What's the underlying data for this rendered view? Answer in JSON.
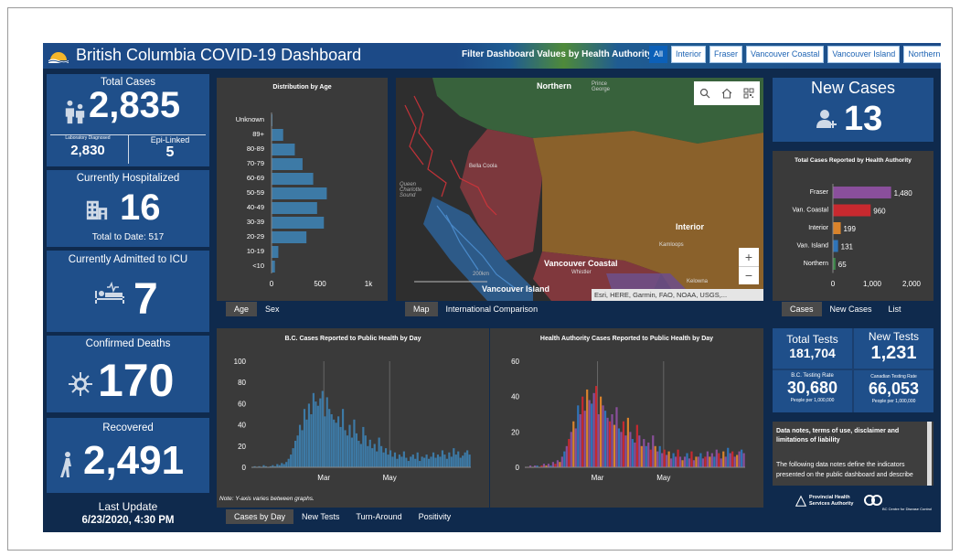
{
  "header": {
    "title": "British Columbia COVID-19 Dashboard",
    "filter_label": "Filter Dashboard Values by Health Authority:",
    "filters": [
      "All",
      "Interior",
      "Fraser",
      "Vancouver Coastal",
      "Vancouver Island",
      "Northern"
    ],
    "active_filter": "All"
  },
  "total_cases": {
    "label": "Total Cases",
    "value": "2,835",
    "lab_label": "Laboratory Diagnosed",
    "lab_value": "2,830",
    "epi_label": "Epi-Linked",
    "epi_value": "5"
  },
  "hospitalized": {
    "label": "Currently Hospitalized",
    "value": "16",
    "total_label": "Total to Date: 517"
  },
  "icu": {
    "label": "Currently Admitted to ICU",
    "value": "7"
  },
  "deaths": {
    "label": "Confirmed Deaths",
    "value": "170"
  },
  "recovered": {
    "label": "Recovered",
    "value": "2,491"
  },
  "last_update": {
    "label": "Last Update",
    "value": "6/23/2020, 4:30 PM"
  },
  "age_chart": {
    "tabs": [
      "Age",
      "Sex"
    ],
    "active_tab": "Age"
  },
  "map": {
    "labels": {
      "northern": "Northern",
      "prince_george": "Prince George",
      "bella_coola": "Bella Coola",
      "queen_charlotte": "Queen Charlotte Sound",
      "interior": "Interior",
      "kamloops": "Kamloops",
      "vancouver_coastal": "Vancouver Coastal",
      "whistler": "Whistler",
      "vancouver_island": "Vancouver Island",
      "kelowna": "Kelowna",
      "scale": "200km"
    },
    "attribution": "Esri, HERE, Garmin, FAO, NOAA, USGS,...",
    "zoom_in": "+",
    "zoom_out": "−",
    "tabs": [
      "Map",
      "International Comparison"
    ],
    "active_tab": "Map"
  },
  "new_cases": {
    "label": "New Cases",
    "value": "13"
  },
  "ha_chart": {
    "tabs": [
      "Cases",
      "New Cases",
      "List"
    ],
    "active_tab": "Cases"
  },
  "bc_daily": {
    "note": "Note: Y-axis varies between graphs.",
    "tabs": [
      "Cases by Day",
      "New Tests",
      "Turn-Around",
      "Positivity"
    ],
    "active_tab": "Cases by Day"
  },
  "tests": {
    "total_label": "Total Tests",
    "total_value": "181,704",
    "new_label": "New Tests",
    "new_value": "1,231",
    "bc_rate_label": "B.C. Testing Rate",
    "bc_rate_value": "30,680",
    "bc_rate_unit": "People per 1,000,000",
    "ca_rate_label": "Canadian Testing Rate",
    "ca_rate_value": "66,053",
    "ca_rate_unit": "People per 1,000,000"
  },
  "notes": {
    "title": "Data notes, terms of use, disclaimer and limitations of liability",
    "body": "The following data notes define the indicators presented on the public dashboard and describe"
  },
  "footer_logos": {
    "phsa_line1": "Provincial Health",
    "phsa_line2": "Services Authority",
    "bccdc": "BC Centre for Disease Control"
  },
  "colors": {
    "fraser": "#8a4f9c",
    "vancouver_coastal": "#c8292f",
    "interior": "#d9832b",
    "vancouver_island": "#2f74b8",
    "northern": "#3d8a4a",
    "bars": "#3d7aa6"
  },
  "chart_data": [
    {
      "type": "bar",
      "title": "Distribution by Age",
      "orientation": "horizontal",
      "categories": [
        "Unknown",
        "89+",
        "80-89",
        "70-79",
        "60-69",
        "50-59",
        "40-49",
        "30-39",
        "20-29",
        "10-19",
        "<10"
      ],
      "values": [
        5,
        120,
        240,
        320,
        430,
        570,
        470,
        540,
        360,
        70,
        35
      ],
      "xticks": [
        "0",
        "500",
        "1k"
      ],
      "xlim": [
        0,
        1000
      ]
    },
    {
      "type": "bar",
      "title": "Total Cases Reported by Health Authority",
      "orientation": "horizontal",
      "categories": [
        "Fraser",
        "Van. Coastal",
        "Interior",
        "Van. Island",
        "Northern"
      ],
      "values": [
        1480,
        960,
        199,
        131,
        65
      ],
      "value_labels": [
        "1,480",
        "960",
        "199",
        "131",
        "65"
      ],
      "xticks": [
        "0",
        "1,000",
        "2,000"
      ],
      "xlim": [
        0,
        2000
      ]
    },
    {
      "type": "bar",
      "title": "B.C. Cases Reported to Public Health by Day",
      "yticks": [
        "0",
        "20",
        "40",
        "60",
        "80",
        "100"
      ],
      "ylim": [
        0,
        100
      ],
      "xtick_labels": [
        "Mar",
        "May"
      ],
      "values": [
        0,
        1,
        0,
        1,
        0,
        2,
        1,
        0,
        1,
        2,
        1,
        3,
        2,
        4,
        3,
        5,
        8,
        12,
        18,
        25,
        30,
        40,
        35,
        55,
        45,
        60,
        50,
        70,
        62,
        58,
        65,
        72,
        48,
        66,
        55,
        50,
        45,
        42,
        48,
        38,
        55,
        35,
        30,
        40,
        28,
        45,
        32,
        25,
        22,
        38,
        30,
        20,
        26,
        18,
        22,
        15,
        28,
        20,
        14,
        18,
        12,
        16,
        10,
        14,
        8,
        12,
        10,
        15,
        9,
        6,
        10,
        12,
        8,
        14,
        6,
        10,
        9,
        12,
        8,
        10,
        14,
        9,
        12,
        10,
        16,
        12,
        8,
        14,
        10,
        18,
        12,
        15,
        9,
        11,
        14,
        16,
        12
      ]
    },
    {
      "type": "bar",
      "title": "Health Authority Cases Reported to Public Health by Day",
      "yticks": [
        "0",
        "20",
        "40",
        "60"
      ],
      "ylim": [
        0,
        60
      ],
      "xtick_labels": [
        "Mar",
        "May"
      ],
      "values": [
        0,
        0,
        1,
        0,
        1,
        1,
        0,
        1,
        2,
        1,
        2,
        1,
        3,
        2,
        4,
        3,
        6,
        9,
        12,
        16,
        20,
        26,
        22,
        35,
        30,
        40,
        32,
        44,
        38,
        36,
        42,
        46,
        30,
        40,
        35,
        32,
        28,
        26,
        30,
        24,
        34,
        22,
        20,
        26,
        18,
        28,
        20,
        16,
        14,
        24,
        18,
        12,
        16,
        12,
        14,
        10,
        18,
        12,
        9,
        12,
        8,
        10,
        7,
        9,
        5,
        8,
        6,
        10,
        6,
        4,
        6,
        8,
        5,
        9,
        4,
        6,
        6,
        8,
        5,
        6,
        9,
        6,
        8,
        6,
        10,
        8,
        5,
        9,
        6,
        11,
        8,
        9,
        6,
        7,
        9,
        10,
        8
      ]
    }
  ]
}
